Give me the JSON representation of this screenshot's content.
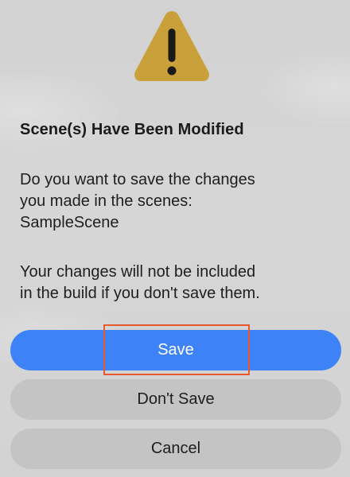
{
  "dialog": {
    "icon": "warning-triangle-icon",
    "icon_color": "#C9A03A",
    "title": "Scene(s) Have Been Modified",
    "message_lines": [
      "Do you want to save the changes",
      "you made in the scenes:",
      "SampleScene"
    ],
    "info_lines": [
      "Your changes will not be included",
      "in the build if you don't save them."
    ]
  },
  "buttons": {
    "save_label": "Save",
    "dont_save_label": "Don't Save",
    "cancel_label": "Cancel"
  },
  "colors": {
    "primary_button": "#3D83F7",
    "secondary_button": "#C4C4C4",
    "highlight": "#E8582F"
  }
}
